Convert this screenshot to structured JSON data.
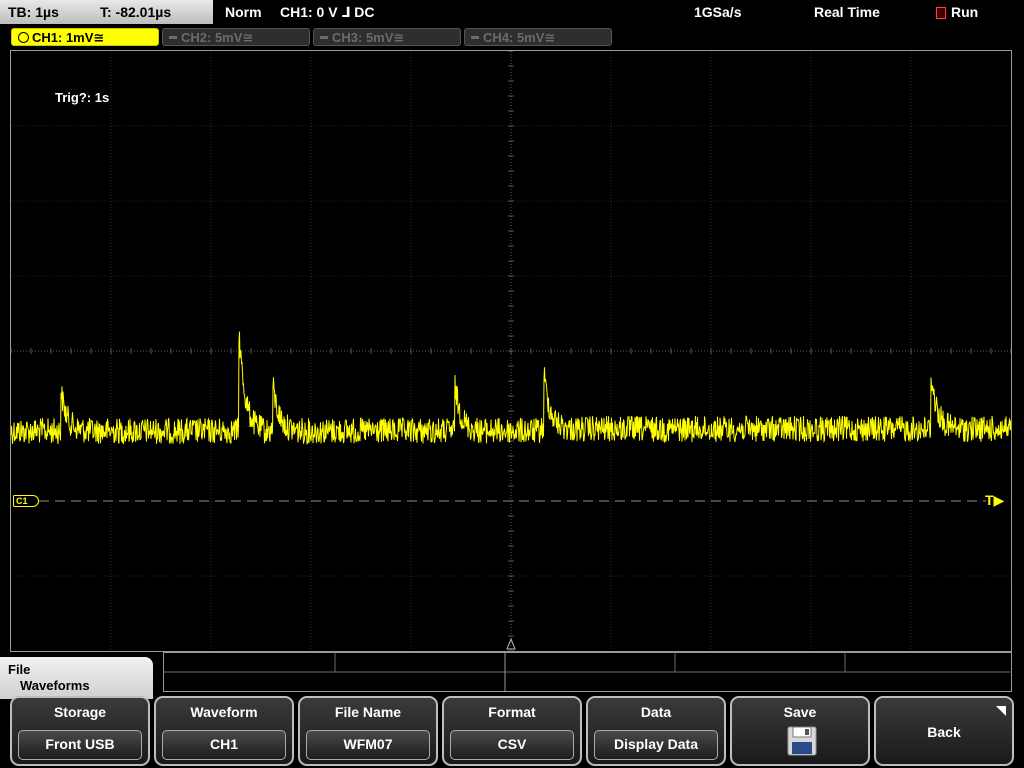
{
  "colors": {
    "trace": "#ffff00",
    "grid": "#7a7a7a",
    "accent": "#ffff00",
    "run": "#ff4040"
  },
  "status": {
    "timebase": "TB: 1µs",
    "trigger_time": "T: -82.01µs",
    "mode": "Norm",
    "trigger_source": "CH1: 0 V ⅃ DC",
    "sample_rate": "1GSa/s",
    "acq_mode": "Real Time",
    "run_state": "Run"
  },
  "channels": [
    {
      "label": "CH1: 1mV≅"
    },
    {
      "label": "CH2: 5mV≅"
    },
    {
      "label": "CH3: 5mV≅"
    },
    {
      "label": "CH4: 5mV≅"
    }
  ],
  "screen": {
    "trigger_info": "Trig?: 1s",
    "ch1_marker": "C1",
    "trigger_marker": "T▶"
  },
  "menu": {
    "path_line1": "File",
    "path_line2": "Waveforms",
    "keys": [
      {
        "label": "Storage",
        "value": "Front USB"
      },
      {
        "label": "Waveform",
        "value": "CH1"
      },
      {
        "label": "File Name",
        "value": "WFM07"
      },
      {
        "label": "Format",
        "value": "CSV"
      },
      {
        "label": "Data",
        "value": "Display Data"
      },
      {
        "label": "Save",
        "icon": "floppy-disk-icon"
      },
      {
        "label": "Back"
      }
    ]
  }
}
